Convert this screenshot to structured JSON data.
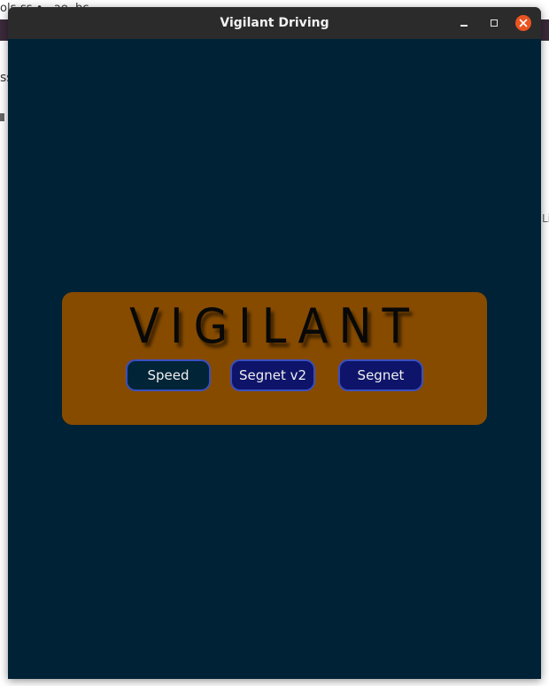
{
  "background": {
    "top_text": "ols-ss • ..ae..bc..",
    "left_text": "ss",
    "right_text": "Li"
  },
  "window": {
    "title": "Vigilant Driving",
    "controls": {
      "minimize_icon": "minimize-icon",
      "maximize_icon": "maximize-icon",
      "close_icon": "close-icon"
    }
  },
  "panel": {
    "logo_text": "VIGILANT",
    "buttons": [
      {
        "label": "Speed"
      },
      {
        "label": "Segnet v2"
      },
      {
        "label": "Segnet"
      }
    ]
  },
  "colors": {
    "window_bg": "#002236",
    "titlebar_bg": "#2b2b2b",
    "panel_bg": "#874b00",
    "button_active_bg": "#012437",
    "button_bg": "#0e1469",
    "button_border": "#3a4fbf",
    "close_button": "#e95420"
  }
}
